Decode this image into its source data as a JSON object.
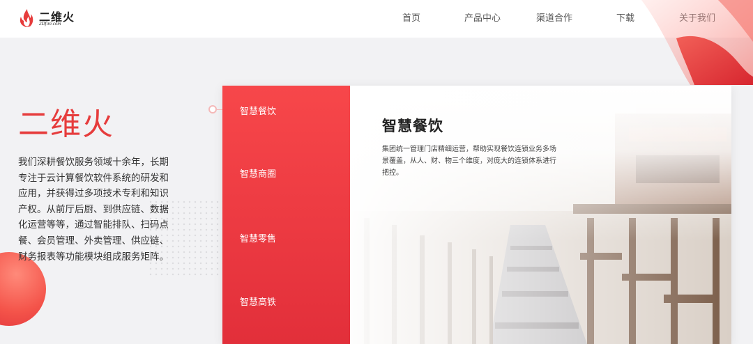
{
  "brand": {
    "name": "二维火",
    "domain": "2Dfire.com"
  },
  "nav": {
    "items": [
      {
        "label": "首页"
      },
      {
        "label": "产品中心"
      },
      {
        "label": "渠道合作"
      },
      {
        "label": "下载"
      },
      {
        "label": "关于我们"
      }
    ]
  },
  "hero": {
    "title": "二维火",
    "description": "我们深耕餐饮服务领域十余年，长期专注于云计算餐饮软件系统的研发和应用，并获得过多项技术专利和知识产权。从前厅后厨、到供应链、数据化运营等等，通过智能排队、扫码点餐、会员管理、外卖管理、供应链、财务报表等功能模块组成服务矩阵。"
  },
  "solutions": {
    "tabs": [
      {
        "label": "智慧餐饮",
        "active": true
      },
      {
        "label": "智慧商圈",
        "active": false
      },
      {
        "label": "智慧零售",
        "active": false
      },
      {
        "label": "智慧高铁",
        "active": false
      }
    ],
    "panel": {
      "title": "智慧餐饮",
      "description": "集团统一管理门店精细运营，帮助实现餐饮连锁业务多场景覆盖，从人、财、物三个维度，对庞大的连锁体系进行把控。"
    }
  },
  "colors": {
    "brand_red": "#e63c3c",
    "tab_gradient_top": "#f7474a",
    "tab_gradient_bottom": "#e22f3a",
    "background": "#f2f2f4"
  },
  "icons": [
    "flame-logo-icon"
  ]
}
